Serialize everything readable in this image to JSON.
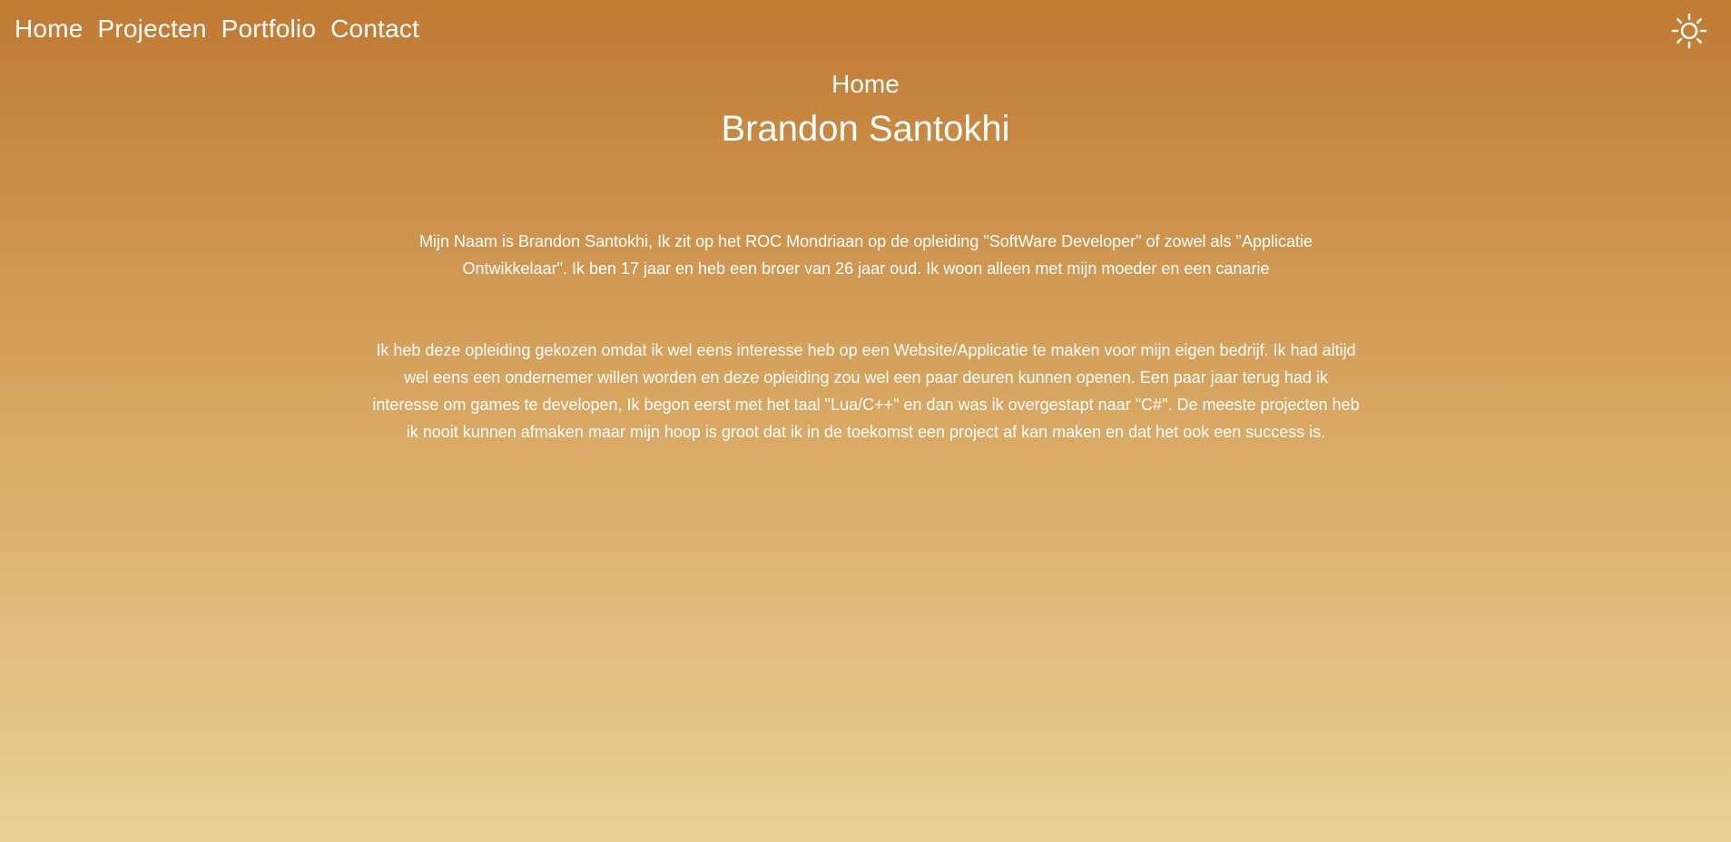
{
  "nav": {
    "items": [
      {
        "label": "Home"
      },
      {
        "label": "Projecten"
      },
      {
        "label": "Portfolio"
      },
      {
        "label": "Contact"
      }
    ]
  },
  "theme_toggle": {
    "icon": "sun-icon"
  },
  "header": {
    "page_label": "Home",
    "title": "Brandon Santokhi"
  },
  "content": {
    "paragraphs": [
      "Mijn Naam is Brandon Santokhi, Ik zit op het ROC Mondriaan op de opleiding \"SoftWare Developer\" of zowel als \"Applicatie Ontwikkelaar\". Ik ben 17 jaar en heb een broer van 26 jaar oud. Ik woon alleen met mijn moeder en een canarie",
      "Ik heb deze opleiding gekozen omdat ik wel eens interesse heb op een Website/Applicatie te maken voor mijn eigen bedrijf. Ik had altijd wel eens een ondernemer willen worden en deze opleiding zou wel een paar deuren kunnen openen. Een paar jaar terug had ik interesse om games te developen, Ik begon eerst met het taal \"Lua/C++\" en dan was ik overgestapt naar \"C#\". De meeste projecten heb ik nooit kunnen afmaken maar mijn hoop is groot dat ik in de toekomst een project af kan maken en dat het ook een success is."
    ]
  },
  "colors": {
    "gradient_top": "#c07a33",
    "gradient_mid": "#d8a863",
    "gradient_bottom": "#e9d196",
    "text": "#ffffff"
  }
}
